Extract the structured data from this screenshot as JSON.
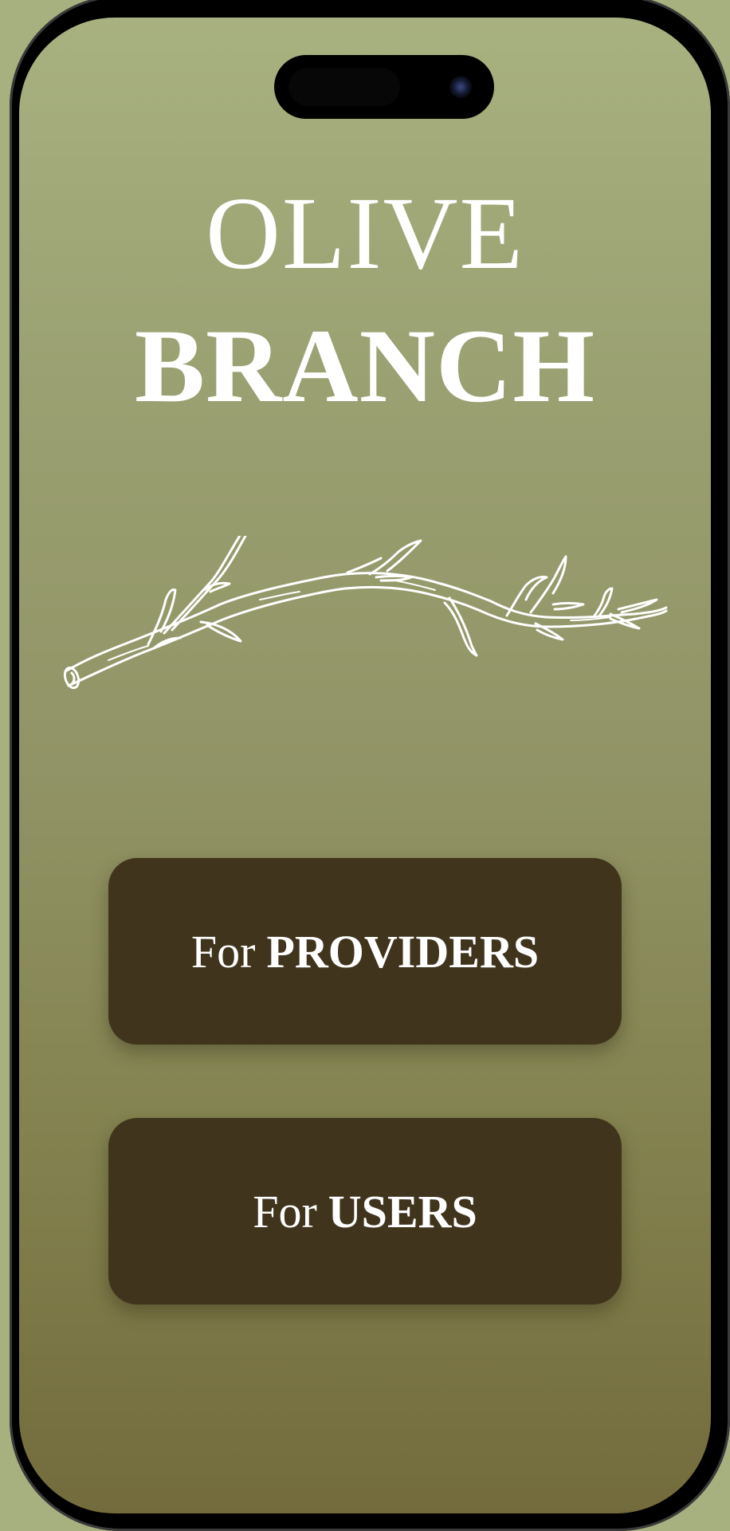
{
  "title": {
    "line1": "OLIVE",
    "line2": "BRANCH"
  },
  "illustration": {
    "icon": "olive-branch-drawing"
  },
  "buttons": {
    "providers": {
      "prefix": "For",
      "emphasis": "PROVIDERS"
    },
    "users": {
      "prefix": "For",
      "emphasis": "USERS"
    }
  },
  "colors": {
    "background_top": "#a8b180",
    "background_bottom": "#736b3c",
    "button_fill": "#41341d",
    "text": "#ffffff"
  }
}
